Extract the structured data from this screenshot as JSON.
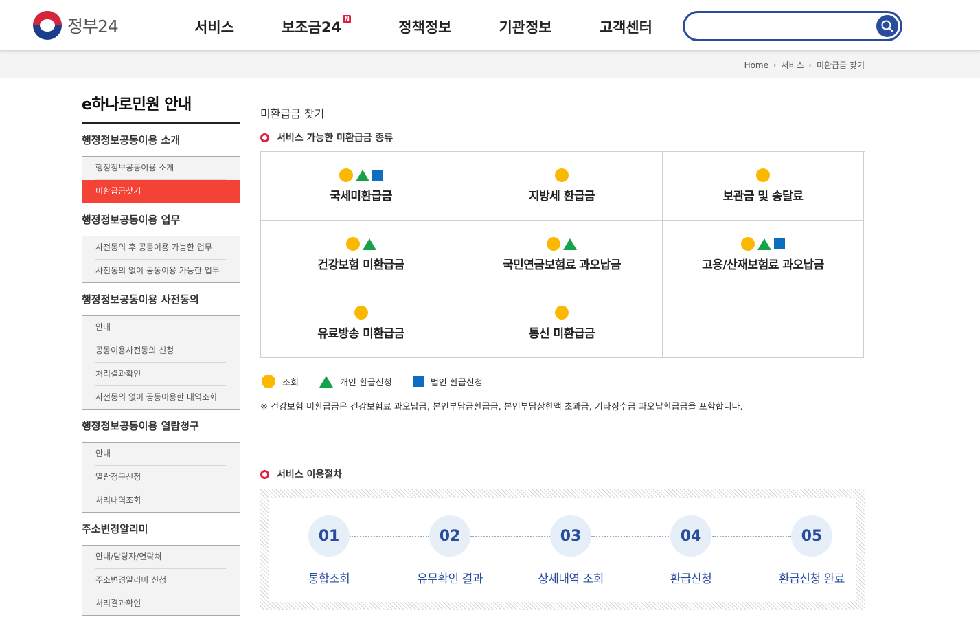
{
  "header": {
    "logo_text": "정부24",
    "nav": [
      {
        "label": "서비스",
        "badge": ""
      },
      {
        "label": "보조금24",
        "badge": "N"
      },
      {
        "label": "정책정보",
        "badge": ""
      },
      {
        "label": "기관정보",
        "badge": ""
      },
      {
        "label": "고객센터",
        "badge": ""
      }
    ],
    "search": {
      "value": "",
      "placeholder": ""
    }
  },
  "breadcrumb": [
    "Home",
    "서비스",
    "미환급금 찾기"
  ],
  "sidebar": {
    "title": "e하나로민원 안내",
    "groups": [
      {
        "title": "행정정보공동이용 소개",
        "items": [
          "행정정보공동이용 소개",
          "미환급금찾기"
        ],
        "active": 1
      },
      {
        "title": "행정정보공동이용 업무",
        "items": [
          "사전동의 후 공동이용 가능한 업무",
          "사전동의 없이 공동이용 가능한 업무"
        ],
        "active": -1
      },
      {
        "title": "행정정보공동이용 사전동의",
        "items": [
          "안내",
          "공동이용사전동의 신청",
          "처리결과확인",
          "사전동의 없이 공동이용한 내역조회"
        ],
        "active": -1
      },
      {
        "title": "행정정보공동이용 열람청구",
        "items": [
          "안내",
          "열람청구신청",
          "처리내역조회"
        ],
        "active": -1
      },
      {
        "title": "주소변경알리미",
        "items": [
          "안내/담당자/연락처",
          "주소변경알리미 신청",
          "처리결과확인"
        ],
        "active": -1
      }
    ]
  },
  "main": {
    "page_title": "미환급금 찾기",
    "section1_title": "서비스 가능한 미환급금 종류",
    "types": [
      {
        "label": "국세미환급금",
        "marks": [
          "circle",
          "triangle",
          "square"
        ]
      },
      {
        "label": "지방세 환급금",
        "marks": [
          "circle"
        ]
      },
      {
        "label": "보관금 및 송달료",
        "marks": [
          "circle"
        ]
      },
      {
        "label": "건강보험 미환급금",
        "marks": [
          "circle",
          "triangle"
        ]
      },
      {
        "label": "국민연금보험료 과오납금",
        "marks": [
          "circle",
          "triangle"
        ]
      },
      {
        "label": "고용/산재보험료 과오납금",
        "marks": [
          "circle",
          "triangle",
          "square"
        ]
      },
      {
        "label": "유료방송 미환급금",
        "marks": [
          "circle"
        ]
      },
      {
        "label": "통신 미환급금",
        "marks": [
          "circle"
        ]
      },
      {
        "label": "",
        "marks": []
      }
    ],
    "legend": [
      {
        "mark": "circle",
        "label": "조회"
      },
      {
        "mark": "triangle",
        "label": "개인 환급신청"
      },
      {
        "mark": "square",
        "label": "법인 환급신청"
      }
    ],
    "note": "※ 건강보험 미환급금은 건강보험료 과오납금, 본인부담금환급금, 본인부담상한액 초과금, 기타징수금 과오납환급금을 포함합니다.",
    "section2_title": "서비스 이용절차",
    "steps": [
      {
        "num": "01",
        "label": "통합조회"
      },
      {
        "num": "02",
        "label": "유무확인 결과"
      },
      {
        "num": "03",
        "label": "상세내역 조회"
      },
      {
        "num": "04",
        "label": "환급신청"
      },
      {
        "num": "05",
        "label": "환급신청 완료"
      }
    ]
  },
  "colors": {
    "accent_blue": "#2a4c9c",
    "active_red": "#f44236",
    "mark_circle": "#fbb800",
    "mark_triangle": "#17a14a",
    "mark_square": "#0d6dbf"
  }
}
